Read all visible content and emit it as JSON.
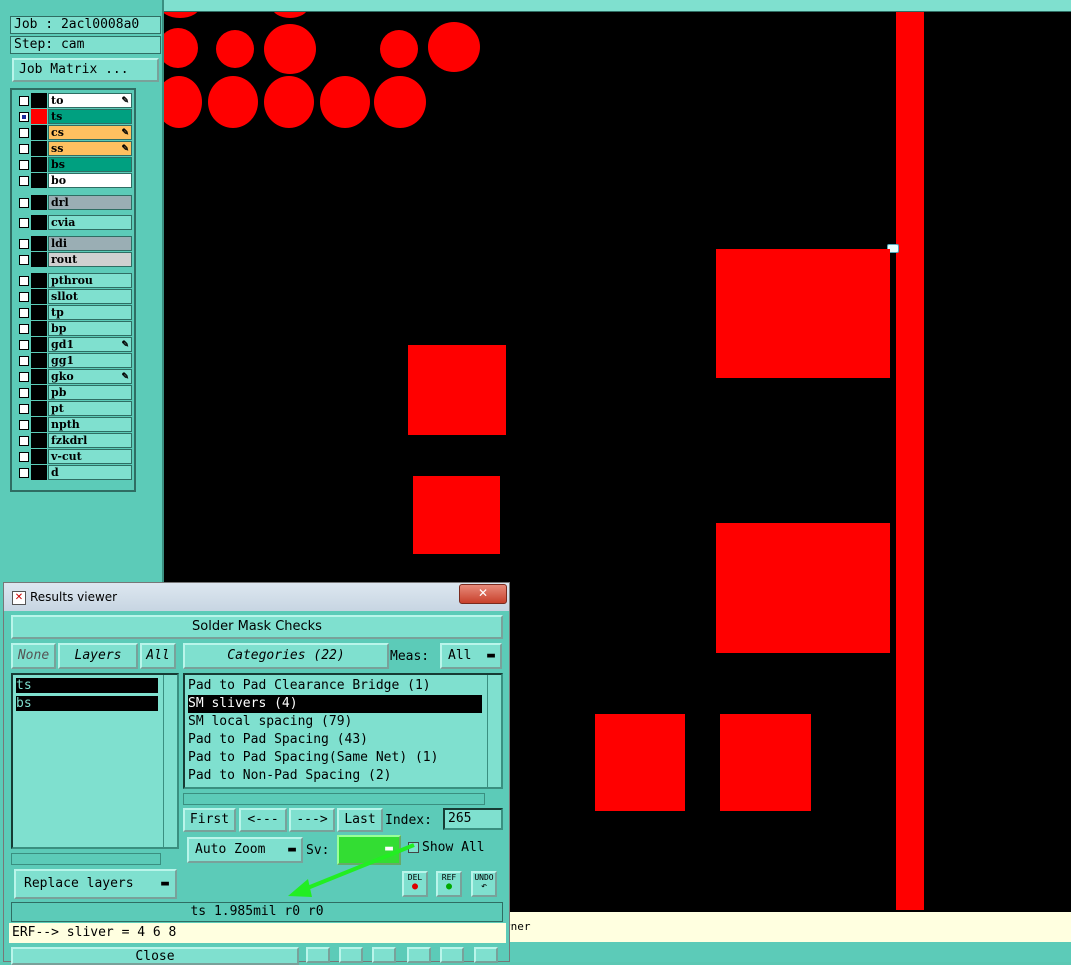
{
  "job": {
    "label": "Job : 2acl0008a0",
    "step": "Step: cam",
    "matrix_button": "Job Matrix ..."
  },
  "layers": [
    {
      "name": "to",
      "color": "#ffffff",
      "checked": false,
      "swatch": "#000000",
      "pen": true
    },
    {
      "name": "ts",
      "color": "#00a080",
      "checked": true,
      "swatch": "#ff0000",
      "pen": false
    },
    {
      "name": "cs",
      "color": "#ffc060",
      "checked": false,
      "swatch": "#000000",
      "pen": true
    },
    {
      "name": "ss",
      "color": "#ffc060",
      "checked": false,
      "swatch": "#000000",
      "pen": true
    },
    {
      "name": "bs",
      "color": "#00a080",
      "checked": false,
      "swatch": "#000000",
      "pen": false
    },
    {
      "name": "bo",
      "color": "#ffffff",
      "checked": false,
      "swatch": "#000000",
      "pen": false
    },
    {
      "name": "drl",
      "color": "#9aaeb4",
      "checked": false,
      "swatch": "#000000",
      "pen": false
    },
    {
      "name": "cvia",
      "color": "#7fe0cf",
      "checked": false,
      "swatch": "#000000",
      "pen": false
    },
    {
      "name": "ldi",
      "color": "#9aaeb4",
      "checked": false,
      "swatch": "#000000",
      "pen": false
    },
    {
      "name": "rout",
      "color": "#d0d0d0",
      "checked": false,
      "swatch": "#000000",
      "pen": false
    },
    {
      "name": "pthrou",
      "color": "#7fe0cf",
      "checked": false,
      "swatch": "#000000",
      "pen": false
    },
    {
      "name": "sllot",
      "color": "#7fe0cf",
      "checked": false,
      "swatch": "#000000",
      "pen": false
    },
    {
      "name": "tp",
      "color": "#7fe0cf",
      "checked": false,
      "swatch": "#000000",
      "pen": false
    },
    {
      "name": "bp",
      "color": "#7fe0cf",
      "checked": false,
      "swatch": "#000000",
      "pen": false
    },
    {
      "name": "gd1",
      "color": "#7fe0cf",
      "checked": false,
      "swatch": "#000000",
      "pen": true
    },
    {
      "name": "gg1",
      "color": "#7fe0cf",
      "checked": false,
      "swatch": "#000000",
      "pen": false
    },
    {
      "name": "gko",
      "color": "#7fe0cf",
      "checked": false,
      "swatch": "#000000",
      "pen": true
    },
    {
      "name": "pb",
      "color": "#7fe0cf",
      "checked": false,
      "swatch": "#000000",
      "pen": false
    },
    {
      "name": "pt",
      "color": "#7fe0cf",
      "checked": false,
      "swatch": "#000000",
      "pen": false
    },
    {
      "name": "npth",
      "color": "#7fe0cf",
      "checked": false,
      "swatch": "#000000",
      "pen": false
    },
    {
      "name": "fzkdrl",
      "color": "#7fe0cf",
      "checked": false,
      "swatch": "#000000",
      "pen": false
    },
    {
      "name": "v-cut",
      "color": "#7fe0cf",
      "checked": false,
      "swatch": "#000000",
      "pen": false
    },
    {
      "name": "d",
      "color": "#7fe0cf",
      "checked": false,
      "swatch": "#000000",
      "pen": false
    }
  ],
  "status_line": "rner",
  "results_viewer": {
    "title": "Results viewer",
    "close_x": "✕",
    "heading": "Solder Mask Checks",
    "none_btn": "None",
    "layers_btn": "Layers",
    "all_btn": "All",
    "layer_list": [
      "ts",
      "bs"
    ],
    "categories_btn": "Categories (22)",
    "meas_label": "Meas:",
    "meas_value": "All",
    "categories": [
      "Pad to Pad Clearance Bridge (1)",
      "SM slivers (4)",
      "SM local spacing (79)",
      "Pad to Pad Spacing (43)",
      "Pad to Pad Spacing(Same Net) (1)",
      "Pad to Non-Pad Spacing (2)"
    ],
    "selected_category": "SM slivers (4)",
    "first_btn": "First",
    "prev_btn": "<---",
    "next_btn": "--->",
    "last_btn": "Last",
    "index_label": "Index:",
    "index_value": "265",
    "replace_btn": "Replace layers",
    "auto_zoom": "Auto Zoom",
    "sv_label": "Sv:",
    "sv_color": "#33dd33",
    "show_all": "Show All",
    "del_label": "DEL",
    "ref_label": "REF",
    "undo_label": "UNDO",
    "result_line": "ts 1.985mil  r0  r0",
    "erf_line": "ERF--> sliver = 4 6 8",
    "close_btn": "Close"
  }
}
